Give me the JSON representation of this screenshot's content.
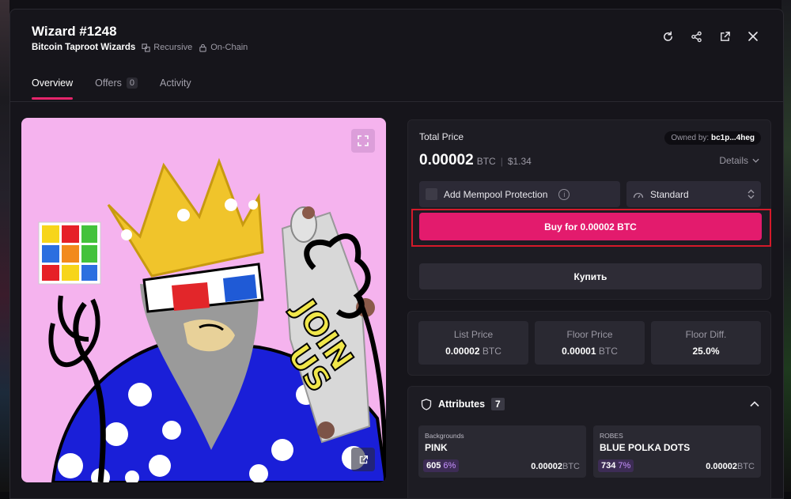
{
  "header": {
    "title": "Wizard #1248",
    "collection": "Bitcoin Taproot Wizards",
    "tag_recursive": "Recursive",
    "tag_onchain": "On-Chain"
  },
  "tabs": {
    "overview": "Overview",
    "offers": "Offers",
    "offers_count": "0",
    "activity": "Activity"
  },
  "art": {
    "scroll_text_1": "JOIN",
    "scroll_text_2": "US",
    "background_color": "#f5b3ee"
  },
  "price": {
    "label": "Total Price",
    "owned_label": "Owned by:",
    "owner": "bc1p...4heg",
    "amount": "0.00002",
    "unit": "BTC",
    "separator": "|",
    "usd": "$1.34",
    "details_label": "Details"
  },
  "options": {
    "mempool_label": "Add Mempool Protection",
    "info_glyph": "i",
    "fee_label": "Standard"
  },
  "actions": {
    "buy_label": "Buy for 0.00002 BTC",
    "kupit_label": "Купить",
    "buy_color": "#e31b6d"
  },
  "stats": [
    {
      "label": "List Price",
      "value": "0.00002",
      "unit": "BTC"
    },
    {
      "label": "Floor Price",
      "value": "0.00001",
      "unit": "BTC"
    },
    {
      "label": "Floor Diff.",
      "value": "25.0%",
      "unit": ""
    }
  ],
  "attributes": {
    "title": "Attributes",
    "count": "7",
    "items": [
      {
        "category": "Backgrounds",
        "name": "PINK",
        "count": "605",
        "percent": "6%",
        "price": "0.00002",
        "unit": "BTC"
      },
      {
        "category": "ROBES",
        "name": "BLUE POLKA DOTS",
        "count": "734",
        "percent": "7%",
        "price": "0.00002",
        "unit": "BTC"
      }
    ]
  }
}
